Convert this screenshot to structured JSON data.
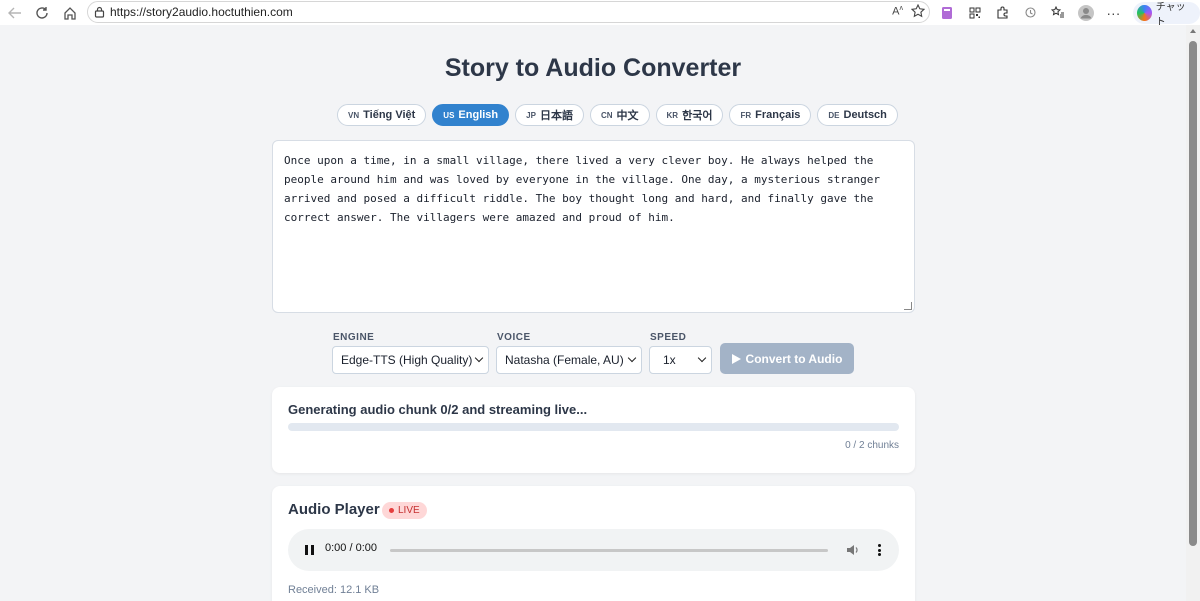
{
  "browser": {
    "url": "https://story2audio.hoctuthien.com",
    "copilot_label": "チャット"
  },
  "page": {
    "title": "Story to Audio Converter"
  },
  "languages": [
    {
      "code": "VN",
      "label": "Tiếng Việt",
      "active": false
    },
    {
      "code": "US",
      "label": "English",
      "active": true
    },
    {
      "code": "JP",
      "label": "日本語",
      "active": false
    },
    {
      "code": "CN",
      "label": "中文",
      "active": false
    },
    {
      "code": "KR",
      "label": "한국어",
      "active": false
    },
    {
      "code": "FR",
      "label": "Français",
      "active": false
    },
    {
      "code": "DE",
      "label": "Deutsch",
      "active": false
    }
  ],
  "story_text": "Once upon a time, in a small village, there lived a very clever boy. He always helped the people around him and was loved by everyone in the village. One day, a mysterious stranger arrived and posed a difficult riddle. The boy thought long and hard, and finally gave the correct answer. The villagers were amazed and proud of him.",
  "controls": {
    "engine_label": "ENGINE",
    "engine_value": "Edge-TTS (High Quality)",
    "voice_label": "VOICE",
    "voice_value": "Natasha (Female, AU)",
    "speed_label": "SPEED",
    "speed_value": "1x",
    "convert_label": "Convert to Audio"
  },
  "progress": {
    "status": "Generating audio chunk 0/2 and streaming live...",
    "fraction": 0,
    "chunks_text": "0 / 2 chunks"
  },
  "player": {
    "title": "Audio Player",
    "live_label": "LIVE",
    "time": "0:00 / 0:00",
    "received": "Received: 12.1 KB"
  },
  "colors": {
    "accent": "#3182ce",
    "live_bg": "#fed7d7",
    "live_text": "#c53030",
    "button_disabled": "#a3b3c7"
  }
}
